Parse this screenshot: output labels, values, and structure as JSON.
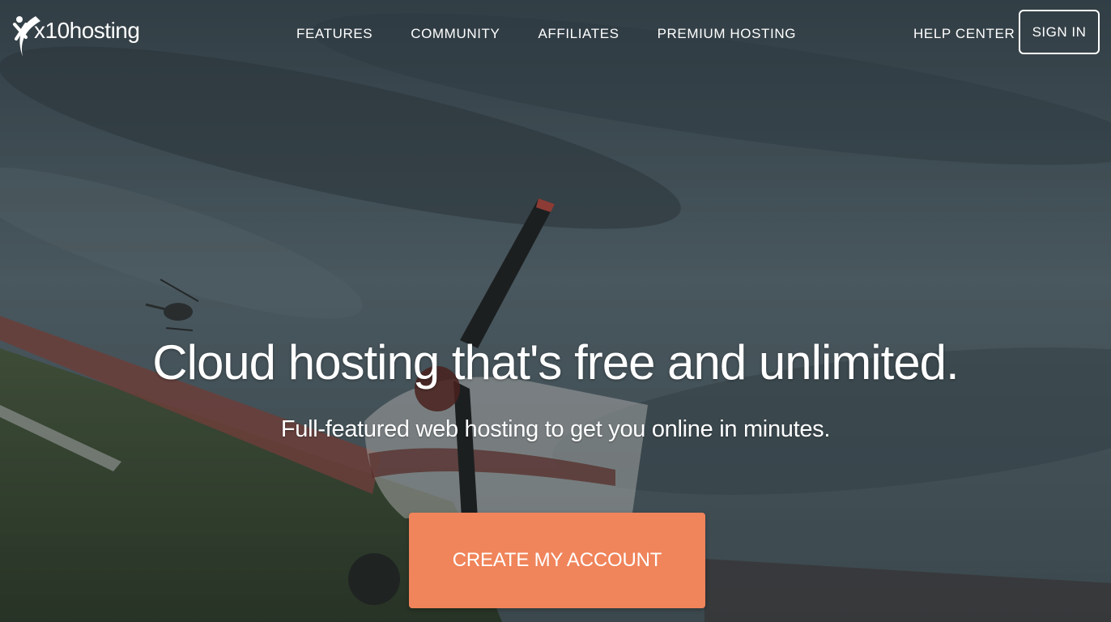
{
  "brand": {
    "name": "x10hosting",
    "logo_icon": "x10-swoosh-logo-icon"
  },
  "nav": {
    "items": [
      {
        "label": "FEATURES"
      },
      {
        "label": "COMMUNITY"
      },
      {
        "label": "AFFILIATES"
      },
      {
        "label": "PREMIUM HOSTING"
      }
    ],
    "help_label": "HELP CENTER",
    "signin_label": "SIGN IN"
  },
  "hero": {
    "headline": "Cloud hosting that's free and unlimited.",
    "subheadline": "Full-featured web hosting to get you online in minutes.",
    "cta_label": "CREATE MY ACCOUNT",
    "background_image": "stormy sky over airfield with propeller plane and helicopter"
  },
  "colors": {
    "cta": "#f0845a",
    "text": "#ffffff",
    "overlay": "#1e262a"
  }
}
